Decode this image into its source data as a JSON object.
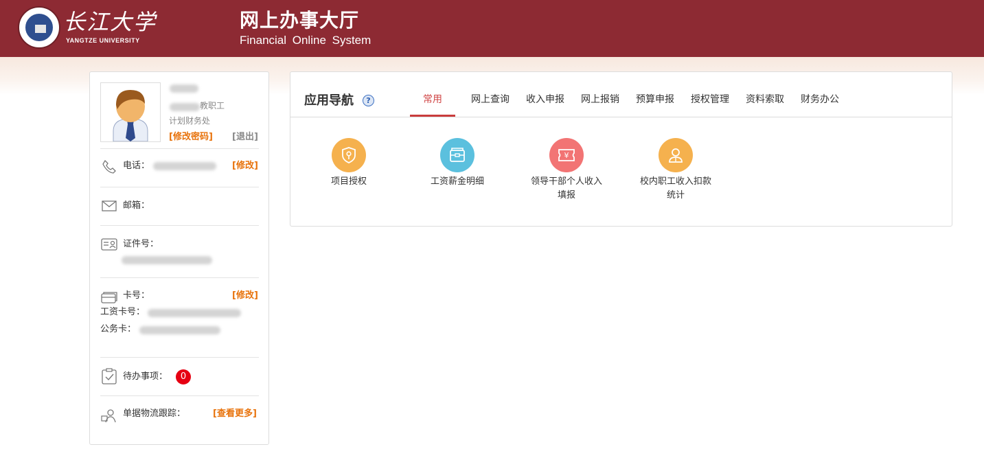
{
  "header": {
    "logo_cn": "长江大学",
    "logo_en": "YANGTZE UNIVERSITY",
    "system_title_cn": "网上办事大厅",
    "system_title_en": "Financial Online System"
  },
  "profile": {
    "role": "教职工",
    "department": "计划财务处",
    "change_password": "[修改密码]",
    "logout": "[退出]",
    "phone_label": "电话：",
    "phone_edit": "[修改]",
    "email_label": "邮箱：",
    "id_label": "证件号：",
    "card_label": "卡号：",
    "card_edit": "[修改]",
    "salary_card_label": "工资卡号：",
    "official_card_label": "公务卡：",
    "todo_label": "待办事项：",
    "todo_count": "0",
    "tracking_label": "单据物流跟踪：",
    "tracking_more": "[查看更多]"
  },
  "nav": {
    "title": "应用导航",
    "help_icon": "?",
    "tabs": [
      "常用",
      "网上查询",
      "收入申报",
      "网上报销",
      "预算申报",
      "授权管理",
      "资料索取",
      "财务办公"
    ],
    "active_tab": 0,
    "apps": [
      {
        "label": "项目授权",
        "color": "#f5b14e",
        "icon": "shield-key-icon"
      },
      {
        "label": "工资薪金明细",
        "color": "#5bc0de",
        "icon": "wallet-icon"
      },
      {
        "label": "领导干部个人收入填报",
        "line1": "领导干部个人收入",
        "line2": "填报",
        "color": "#f27474",
        "icon": "ticket-yen-icon"
      },
      {
        "label": "校内职工收入扣款统计",
        "line1": "校内职工收入扣款",
        "line2": "统计",
        "color": "#f5b14e",
        "icon": "person-icon"
      }
    ]
  },
  "colors": {
    "header_bg": "#8d2a33",
    "accent_orange": "#e8730c",
    "active_tab": "#d04545",
    "badge_red": "#e60012"
  }
}
